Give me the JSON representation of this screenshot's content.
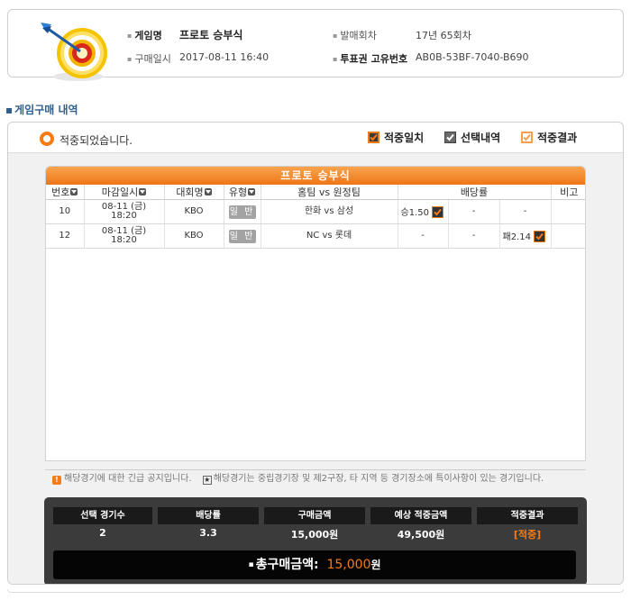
{
  "header": {
    "game_name_label": "게임명",
    "game_name": "프로토 승부식",
    "purchase_time_label": "구매일시",
    "purchase_time": "2017-08-11 16:40",
    "round_label": "발매회차",
    "round": "17년 65회차",
    "ticket_id_label": "투표권 고유번호",
    "ticket_id": "AB0B-53BF-7040-B690"
  },
  "section_title": "게임구매 내역",
  "status": {
    "text": "적중되었습니다.",
    "legend": [
      "적중일치",
      "선택내역",
      "적중결과"
    ]
  },
  "game_table": {
    "title": "프로토 승부식",
    "columns": [
      "번호",
      "마감일시",
      "대회명",
      "유형",
      "홈팀 vs 원정팀",
      "배당률",
      "비고"
    ],
    "rows": [
      {
        "no": "10",
        "deadline_date": "08-11 (금)",
        "deadline_time": "18:20",
        "league": "KBO",
        "type": "일 반",
        "match": "한화 vs 삼성",
        "odds": [
          "승1.50",
          "-",
          "-"
        ],
        "note": ""
      },
      {
        "no": "12",
        "deadline_date": "08-11 (금)",
        "deadline_time": "18:20",
        "league": "KBO",
        "type": "일 반",
        "match": "NC vs 롯데",
        "odds": [
          "-",
          "-",
          "패2.14"
        ],
        "note": ""
      }
    ]
  },
  "notices": {
    "urgent": "해당경기에 대한 긴급 공지입니다.",
    "neutral": "해당경기는 중립경기장 및 제2구장, 타 지역 등 경기장소에 특이사항이 있는 경기입니다."
  },
  "summary": {
    "labels": [
      "선택 경기수",
      "배당률",
      "구매금액",
      "예상 적중금액",
      "적중결과"
    ],
    "values": [
      "2",
      "3.3",
      "15,000원",
      "49,500원",
      "[적중]"
    ],
    "total_label": "총구매금액:",
    "total_amount": "15,000",
    "total_unit": "원"
  },
  "colors": {
    "accent": "#f57b15",
    "section_title": "#2f5e8e"
  }
}
